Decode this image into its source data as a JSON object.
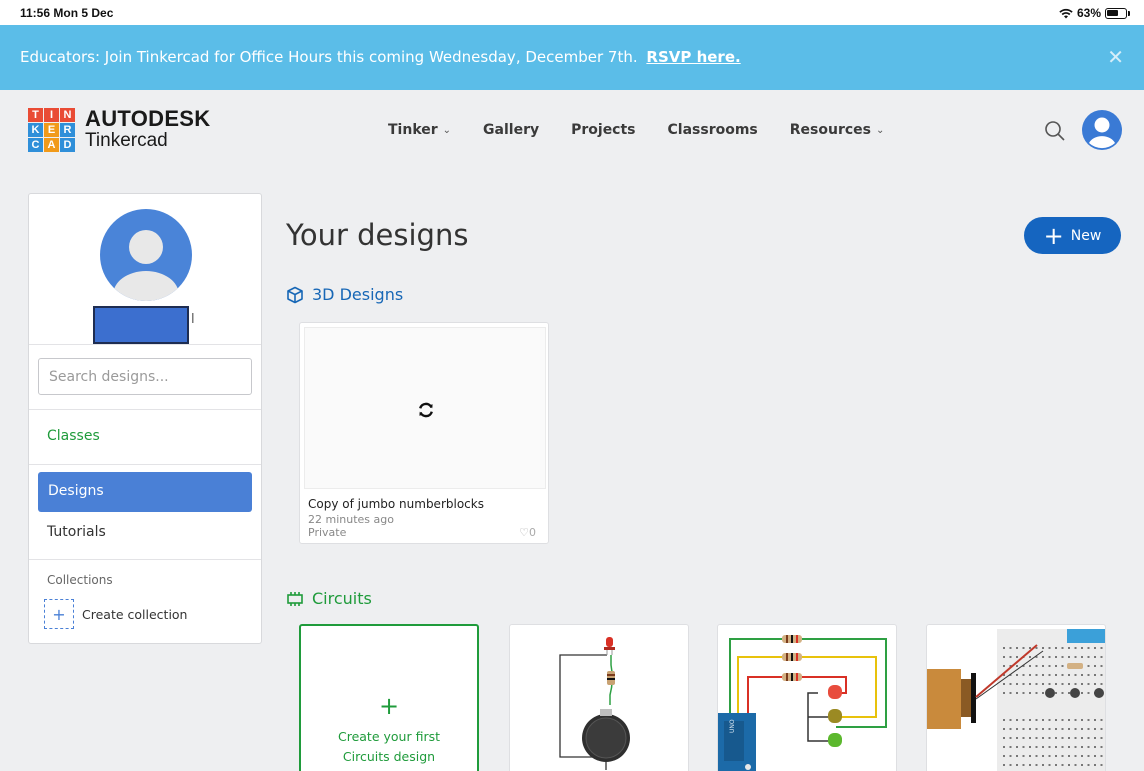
{
  "status_bar": {
    "time": "11:56  Mon 5 Dec",
    "battery": "63%"
  },
  "banner": {
    "message": "Educators: Join Tinkercad for Office Hours this coming Wednesday, December 7th.",
    "link": "RSVP here.",
    "close": "✕"
  },
  "logo": {
    "tiles": [
      "T",
      "I",
      "N",
      "K",
      "E",
      "R",
      "C",
      "A",
      "D"
    ],
    "tile_colors": [
      "#e94b35",
      "#e94b35",
      "#e94b35",
      "#2f8fd9",
      "#f19a1a",
      "#2f8fd9",
      "#2f8fd9",
      "#f19a1a",
      "#2f8fd9"
    ],
    "line1": "AUTODESK",
    "line2": "Tinkercad"
  },
  "nav": [
    {
      "label": "Tinker",
      "dropdown": true
    },
    {
      "label": "Gallery",
      "dropdown": false
    },
    {
      "label": "Projects",
      "dropdown": false
    },
    {
      "label": "Classrooms",
      "dropdown": false
    },
    {
      "label": "Resources",
      "dropdown": true
    }
  ],
  "sidebar": {
    "name_suffix": "l",
    "search_placeholder": "Search designs...",
    "classes": "Classes",
    "designs": "Designs",
    "tutorials": "Tutorials",
    "collections_label": "Collections",
    "create_collection": "Create collection"
  },
  "main": {
    "title": "Your designs",
    "new_label": "New",
    "section_3d": "3D Designs",
    "section_circuits": "Circuits"
  },
  "design": {
    "title": "Copy of jumbo numberblocks",
    "time": "22 minutes ago",
    "visibility": "Private",
    "likes": "0"
  },
  "circuit_first": {
    "line1": "Create your first",
    "line2": "Circuits design"
  },
  "colors": {
    "accent_blue": "#4a80d6",
    "banner": "#5bbde8",
    "green": "#1f9b3b",
    "new_button": "#1565c0"
  }
}
